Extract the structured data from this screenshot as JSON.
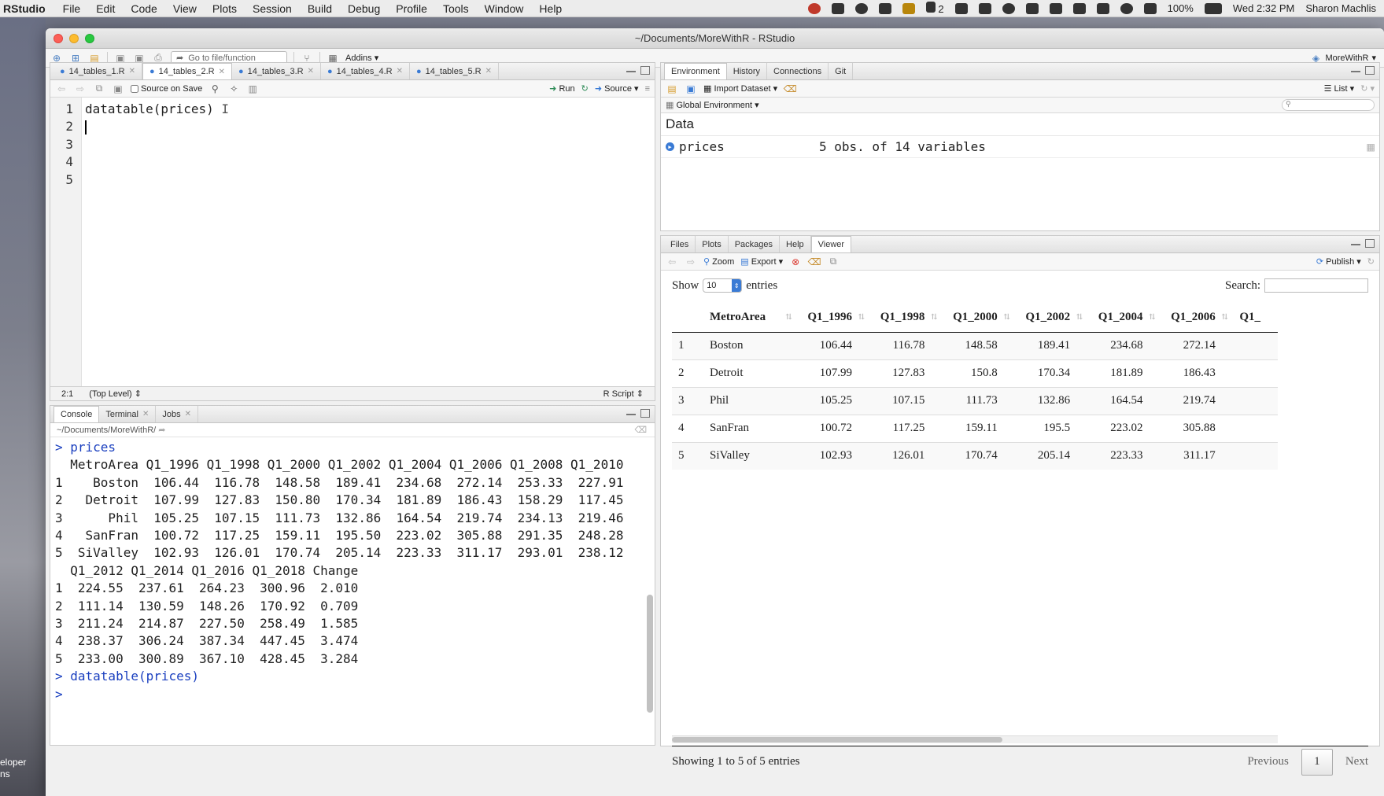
{
  "menubar": {
    "app": "RStudio",
    "items": [
      "File",
      "Edit",
      "Code",
      "View",
      "Plots",
      "Session",
      "Build",
      "Debug",
      "Profile",
      "Tools",
      "Window",
      "Help"
    ],
    "status_a2": "2",
    "battery": "100%",
    "clock": "Wed 2:32 PM",
    "user": "Sharon Machlis"
  },
  "desktop": {
    "label": "eloper\nns"
  },
  "window": {
    "title": "~/Documents/MoreWithR - RStudio"
  },
  "toolbar": {
    "goto_placeholder": "Go to file/function",
    "addins": "Addins",
    "project": "MoreWithR"
  },
  "editor": {
    "tabs": [
      "14_tables_1.R",
      "14_tables_2.R",
      "14_tables_3.R",
      "14_tables_4.R",
      "14_tables_5.R"
    ],
    "active_tab": 1,
    "source_on_save": "Source on Save",
    "run": "Run",
    "source": "Source",
    "line_numbers": [
      "1",
      "2",
      "3",
      "4",
      "5"
    ],
    "code_line1": "datatable(prices)",
    "position": "2:1",
    "scope": "(Top Level)",
    "file_type": "R Script"
  },
  "console": {
    "tabs": [
      "Console",
      "Terminal",
      "Jobs"
    ],
    "path": "~/Documents/MoreWithR/",
    "lines": [
      {
        "text": "> prices",
        "cmd": true
      },
      {
        "text": "  MetroArea Q1_1996 Q1_1998 Q1_2000 Q1_2002 Q1_2004 Q1_2006 Q1_2008 Q1_2010",
        "cmd": false
      },
      {
        "text": "1    Boston  106.44  116.78  148.58  189.41  234.68  272.14  253.33  227.91",
        "cmd": false
      },
      {
        "text": "2   Detroit  107.99  127.83  150.80  170.34  181.89  186.43  158.29  117.45",
        "cmd": false
      },
      {
        "text": "3      Phil  105.25  107.15  111.73  132.86  164.54  219.74  234.13  219.46",
        "cmd": false
      },
      {
        "text": "4   SanFran  100.72  117.25  159.11  195.50  223.02  305.88  291.35  248.28",
        "cmd": false
      },
      {
        "text": "5  SiValley  102.93  126.01  170.74  205.14  223.33  311.17  293.01  238.12",
        "cmd": false
      },
      {
        "text": "  Q1_2012 Q1_2014 Q1_2016 Q1_2018 Change",
        "cmd": false
      },
      {
        "text": "1  224.55  237.61  264.23  300.96  2.010",
        "cmd": false
      },
      {
        "text": "2  111.14  130.59  148.26  170.92  0.709",
        "cmd": false
      },
      {
        "text": "3  211.24  214.87  227.50  258.49  1.585",
        "cmd": false
      },
      {
        "text": "4  238.37  306.24  387.34  447.45  3.474",
        "cmd": false
      },
      {
        "text": "5  233.00  300.89  367.10  428.45  3.284",
        "cmd": false
      },
      {
        "text": "> datatable(prices)",
        "cmd": true
      },
      {
        "text": "> ",
        "cmd": true
      }
    ]
  },
  "env": {
    "tabs": [
      "Environment",
      "History",
      "Connections",
      "Git"
    ],
    "import": "Import Dataset",
    "list": "List",
    "scope": "Global Environment",
    "data_header": "Data",
    "var_name": "prices",
    "var_desc": "5 obs. of 14 variables"
  },
  "viewer": {
    "tabs": [
      "Files",
      "Plots",
      "Packages",
      "Help",
      "Viewer"
    ],
    "zoom": "Zoom",
    "export": "Export",
    "publish": "Publish",
    "show": "Show",
    "entries_value": "10",
    "entries": "entries",
    "search": "Search:",
    "columns": [
      "MetroArea",
      "Q1_1996",
      "Q1_1998",
      "Q1_2000",
      "Q1_2002",
      "Q1_2004",
      "Q1_2006",
      "Q1_"
    ],
    "rows": [
      [
        "1",
        "Boston",
        "106.44",
        "116.78",
        "148.58",
        "189.41",
        "234.68",
        "272.14"
      ],
      [
        "2",
        "Detroit",
        "107.99",
        "127.83",
        "150.8",
        "170.34",
        "181.89",
        "186.43"
      ],
      [
        "3",
        "Phil",
        "105.25",
        "107.15",
        "111.73",
        "132.86",
        "164.54",
        "219.74"
      ],
      [
        "4",
        "SanFran",
        "100.72",
        "117.25",
        "159.11",
        "195.5",
        "223.02",
        "305.88"
      ],
      [
        "5",
        "SiValley",
        "102.93",
        "126.01",
        "170.74",
        "205.14",
        "223.33",
        "311.17"
      ]
    ],
    "showing": "Showing 1 to 5 of 5 entries",
    "previous": "Previous",
    "page": "1",
    "next": "Next"
  }
}
